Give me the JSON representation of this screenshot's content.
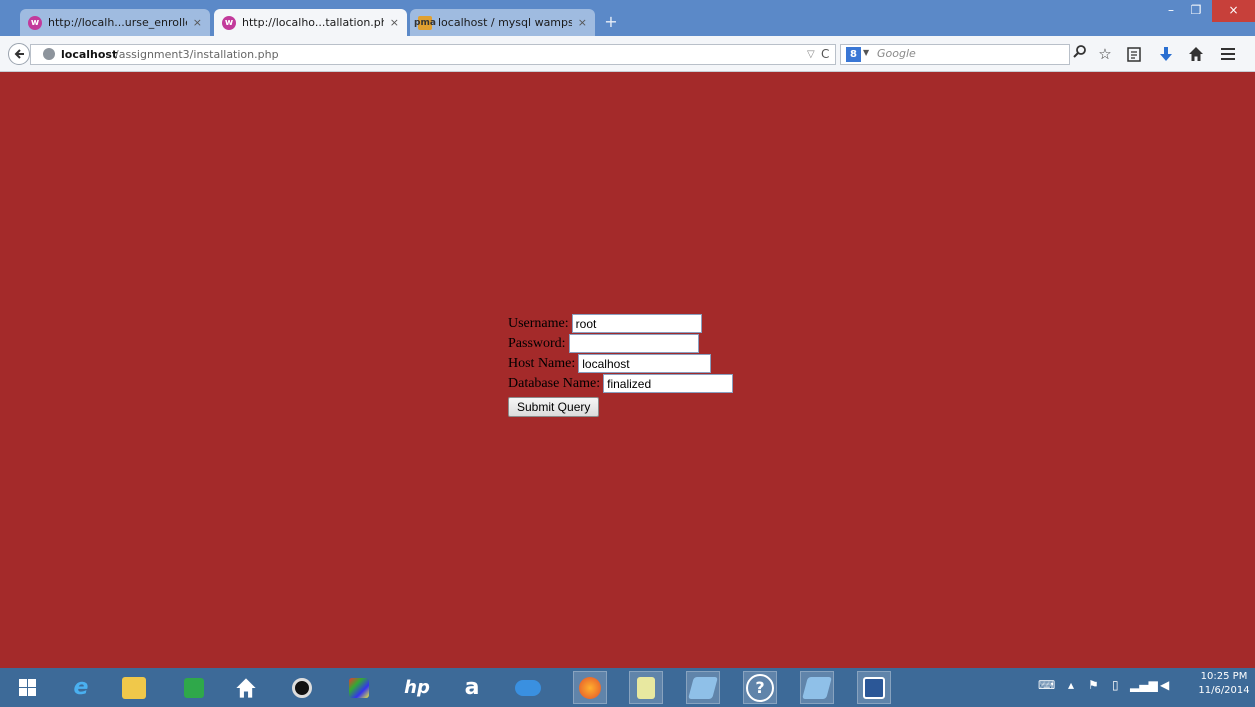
{
  "browser": {
    "tabs": [
      {
        "title": "http://localh...urse_enrolled",
        "favicon": "wamp-icon",
        "active": false
      },
      {
        "title": "http://localho...tallation.php",
        "favicon": "wamp-icon",
        "active": true
      },
      {
        "title": "localhost / mysql wampser...",
        "favicon": "phpmyadmin-icon",
        "active": false
      }
    ],
    "tab_close_glyph": "×",
    "new_tab_glyph": "+",
    "window_controls": {
      "minimize": "–",
      "maximize": "❐",
      "close": "×"
    },
    "url": {
      "host": "localhost",
      "path": "/assignment3/installation.php"
    },
    "search": {
      "engine_glyph": "8",
      "placeholder": "Google"
    }
  },
  "form": {
    "username_label": "Username:",
    "username_value": "root",
    "password_label": "Password:",
    "password_value": "",
    "host_label": "Host Name:",
    "host_value": "localhost",
    "database_label": "Database Name:",
    "database_value": "finalized",
    "submit_label": "Submit Query"
  },
  "taskbar": {
    "pinned": [
      "windows-start-icon",
      "internet-explorer-icon",
      "file-explorer-icon",
      "store-icon",
      "home-icon",
      "webcam-icon",
      "app-icon",
      "hp-icon",
      "amazon-icon",
      "onedrive-icon",
      "firefox-icon",
      "notepad-icon",
      "app-icon",
      "help-icon",
      "app-icon",
      "word-icon"
    ],
    "clock_time": "10:25 PM",
    "clock_date": "11/6/2014"
  },
  "colors": {
    "page_background": "#a42a2a",
    "titlebar": "#5b89c8",
    "taskbar": "#3d6a98"
  }
}
